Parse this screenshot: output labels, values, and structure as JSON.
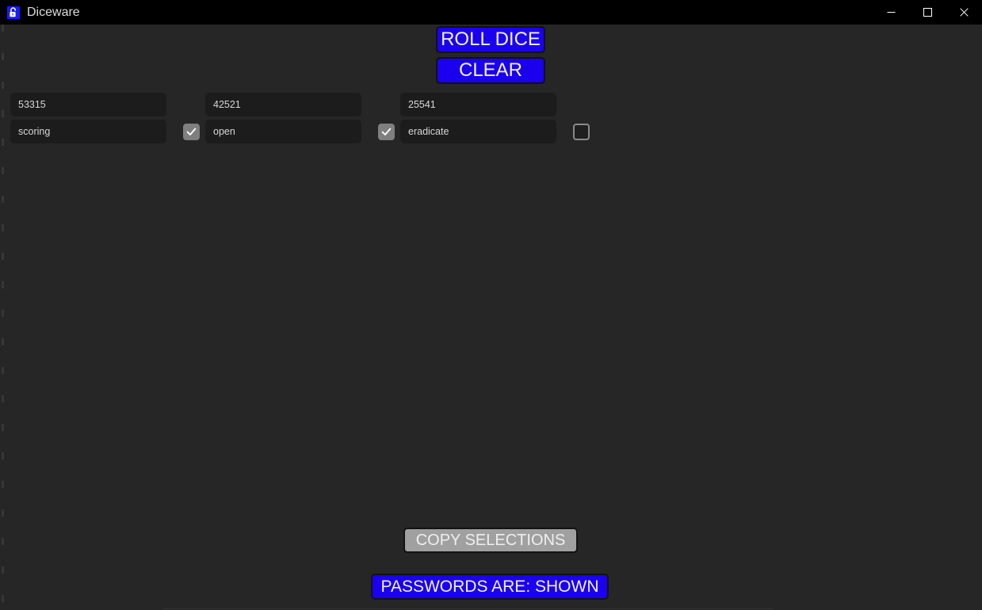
{
  "window": {
    "title": "Diceware",
    "icon": "lock-icon",
    "controls": {
      "minimize": "minimize-icon",
      "maximize": "maximize-icon",
      "close": "close-icon"
    }
  },
  "colors": {
    "background": "#262626",
    "titlebar": "#000000",
    "field_background": "#1c1c1c",
    "accent_blue": "#1a00ee",
    "button_gray": "#a0a0a0",
    "checkbox_checked": "#7f7f7f",
    "text": "#dcdcdc"
  },
  "toolbar": {
    "roll_dice_label": "ROLL DICE",
    "clear_label": "CLEAR"
  },
  "entries": [
    {
      "number": "53315",
      "word": "scoring",
      "selected": true
    },
    {
      "number": "42521",
      "word": "open",
      "selected": true
    },
    {
      "number": "25541",
      "word": "eradicate",
      "selected": false
    }
  ],
  "footer": {
    "copy_selections_label": "COPY SELECTIONS",
    "passwords_toggle_label": "PASSWORDS ARE: SHOWN"
  }
}
